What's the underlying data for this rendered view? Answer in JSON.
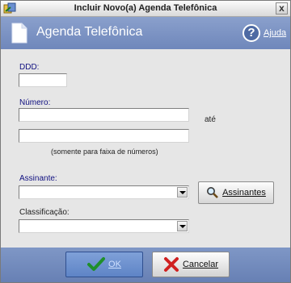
{
  "window": {
    "title": "Incluir Novo(a) Agenda Telefônica",
    "close_glyph": "x"
  },
  "header": {
    "title": "Agenda Telefônica",
    "help_label": "Ajuda",
    "help_glyph": "?"
  },
  "form": {
    "ddd": {
      "label": "DDD:",
      "value": ""
    },
    "numero": {
      "label": "Número:",
      "value_from": "",
      "range_label": "até",
      "value_to": "",
      "note": "(somente para faixa de números)"
    },
    "assinante": {
      "label": "Assinante:",
      "value": "",
      "search_button": "Assinantes"
    },
    "classificacao": {
      "label": "Classificação:",
      "value": ""
    }
  },
  "footer": {
    "ok_label": "OK",
    "cancel_label": "Cancelar"
  },
  "colors": {
    "header": "#7a91c2",
    "footer": "#6f87bb",
    "label": "#101080"
  }
}
